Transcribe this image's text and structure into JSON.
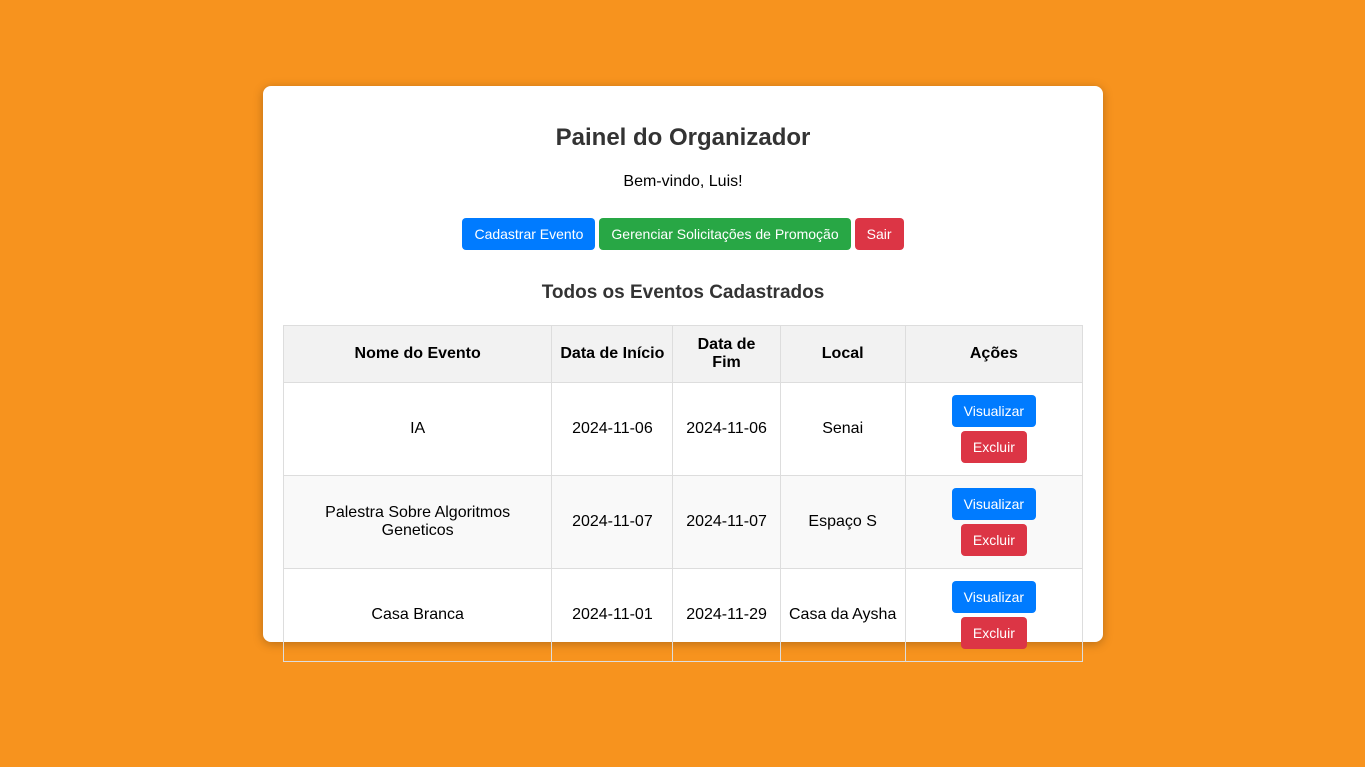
{
  "header": {
    "title": "Painel do Organizador",
    "welcome": "Bem-vindo, Luis!"
  },
  "actions": {
    "register_event": "Cadastrar Evento",
    "manage_requests": "Gerenciar Solicitações de Promoção",
    "logout": "Sair"
  },
  "events_section": {
    "title": "Todos os Eventos Cadastrados",
    "columns": {
      "name": "Nome do Evento",
      "start": "Data de Início",
      "end": "Data de Fim",
      "local": "Local",
      "actions": "Ações"
    },
    "rows": [
      {
        "name": "IA",
        "start": "2024-11-06",
        "end": "2024-11-06",
        "local": "Senai"
      },
      {
        "name": "Palestra Sobre Algoritmos Geneticos",
        "start": "2024-11-07",
        "end": "2024-11-07",
        "local": "Espaço S"
      },
      {
        "name": "Casa Branca",
        "start": "2024-11-01",
        "end": "2024-11-29",
        "local": "Casa da Aysha"
      }
    ],
    "view_label": "Visualizar",
    "delete_label": "Excluir"
  },
  "colors": {
    "background": "#f7931e",
    "primary": "#007bff",
    "success": "#28a745",
    "danger": "#dc3545"
  }
}
